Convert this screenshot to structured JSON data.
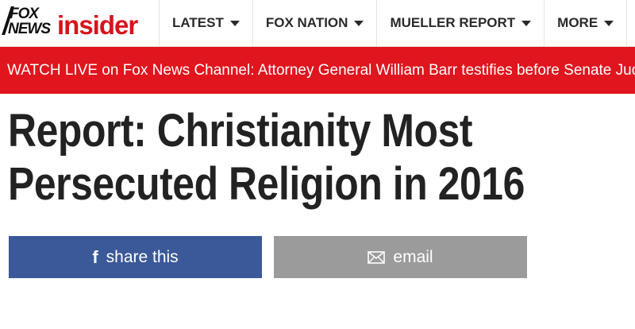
{
  "header": {
    "logo": {
      "fox_text": "FOX",
      "news_text": "NEWS",
      "insider_text": "insider",
      "brand_color": "#d8131c"
    },
    "nav": [
      {
        "label": "LATEST",
        "icon": "chevron-down-icon"
      },
      {
        "label": "FOX NATION",
        "icon": "chevron-down-icon"
      },
      {
        "label": "MUELLER REPORT",
        "icon": "chevron-down-icon"
      },
      {
        "label": "MORE",
        "icon": "chevron-down-icon"
      }
    ]
  },
  "banner": {
    "text": "WATCH LIVE on Fox News Channel: Attorney General William Barr testifies before Senate Jud",
    "background": "#e0151e"
  },
  "article": {
    "headline_line1": "Report: Christianity Most",
    "headline_line2": "Persecuted Religion in 2016"
  },
  "share": {
    "facebook_label": "share this",
    "facebook_icon": "facebook-icon",
    "facebook_color": "#3b5998",
    "email_label": "email",
    "email_icon": "envelope-icon",
    "email_color": "#9b9b9b"
  }
}
